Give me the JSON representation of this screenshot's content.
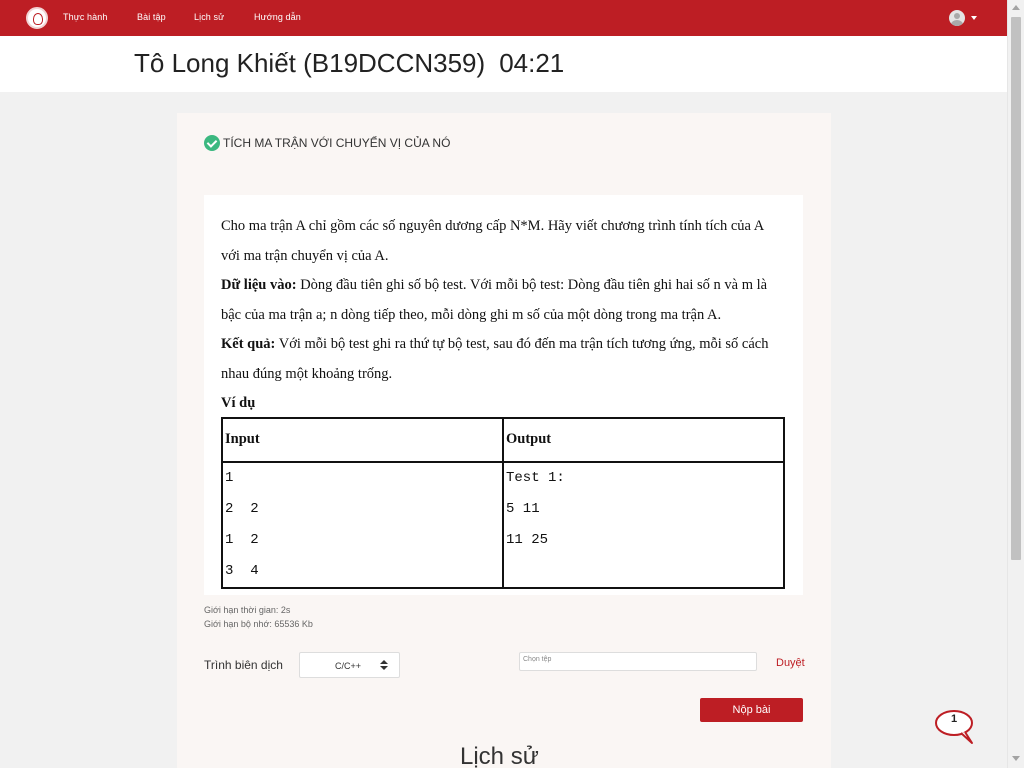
{
  "nav": {
    "items": [
      {
        "label": "Thực hành"
      },
      {
        "label": "Bài tập"
      },
      {
        "label": "Lịch sử"
      },
      {
        "label": "Hướng dẫn"
      }
    ]
  },
  "header": {
    "student": "Tô Long Khiết (B19DCCN359)",
    "timer": "04:21"
  },
  "problem": {
    "name": "TÍCH MA TRẬN VỚI CHUYỂN VỊ CỦA NÓ",
    "status_icon": "check-circle-icon",
    "statement": "Cho ma trận A chỉ gồm các số nguyên dương cấp N*M. Hãy viết chương trình tính tích của A với ma trận chuyển vị của A.",
    "input_label": "Dữ liệu vào:",
    "input_text": " Dòng đầu tiên ghi số bộ test. Với mỗi bộ test: Dòng đầu tiên ghi hai số n và m là bậc của ma trận a; n dòng tiếp theo, mỗi dòng ghi m  số của một dòng trong ma trận A.",
    "output_label": "Kết quả:",
    "output_text": " Với mỗi bộ test ghi ra thứ tự bộ test, sau đó đến ma trận tích tương ứng, mỗi số cách nhau đúng một khoảng trống.",
    "example_label": "Ví dụ",
    "sample": {
      "input_header": "Input",
      "output_header": "Output",
      "input_lines": [
        "1",
        "2  2",
        "1  2",
        "3  4"
      ],
      "output_lines": [
        "Test 1:",
        "5 11",
        "11 25"
      ]
    },
    "time_limit": "Giới hạn thời gian: 2s",
    "memory_limit": "Giới hạn bộ nhớ: 65536 Kb"
  },
  "submit": {
    "compiler_label": "Trình biên dịch",
    "compiler_value": "C/C++",
    "file_placeholder": "Chọn tệp",
    "browse_label": "Duyệt",
    "submit_label": "Nộp bài"
  },
  "history": {
    "title": "Lịch sử"
  },
  "chat": {
    "count": "1"
  },
  "colors": {
    "brand": "#bd1e24",
    "success": "#3bb880"
  }
}
